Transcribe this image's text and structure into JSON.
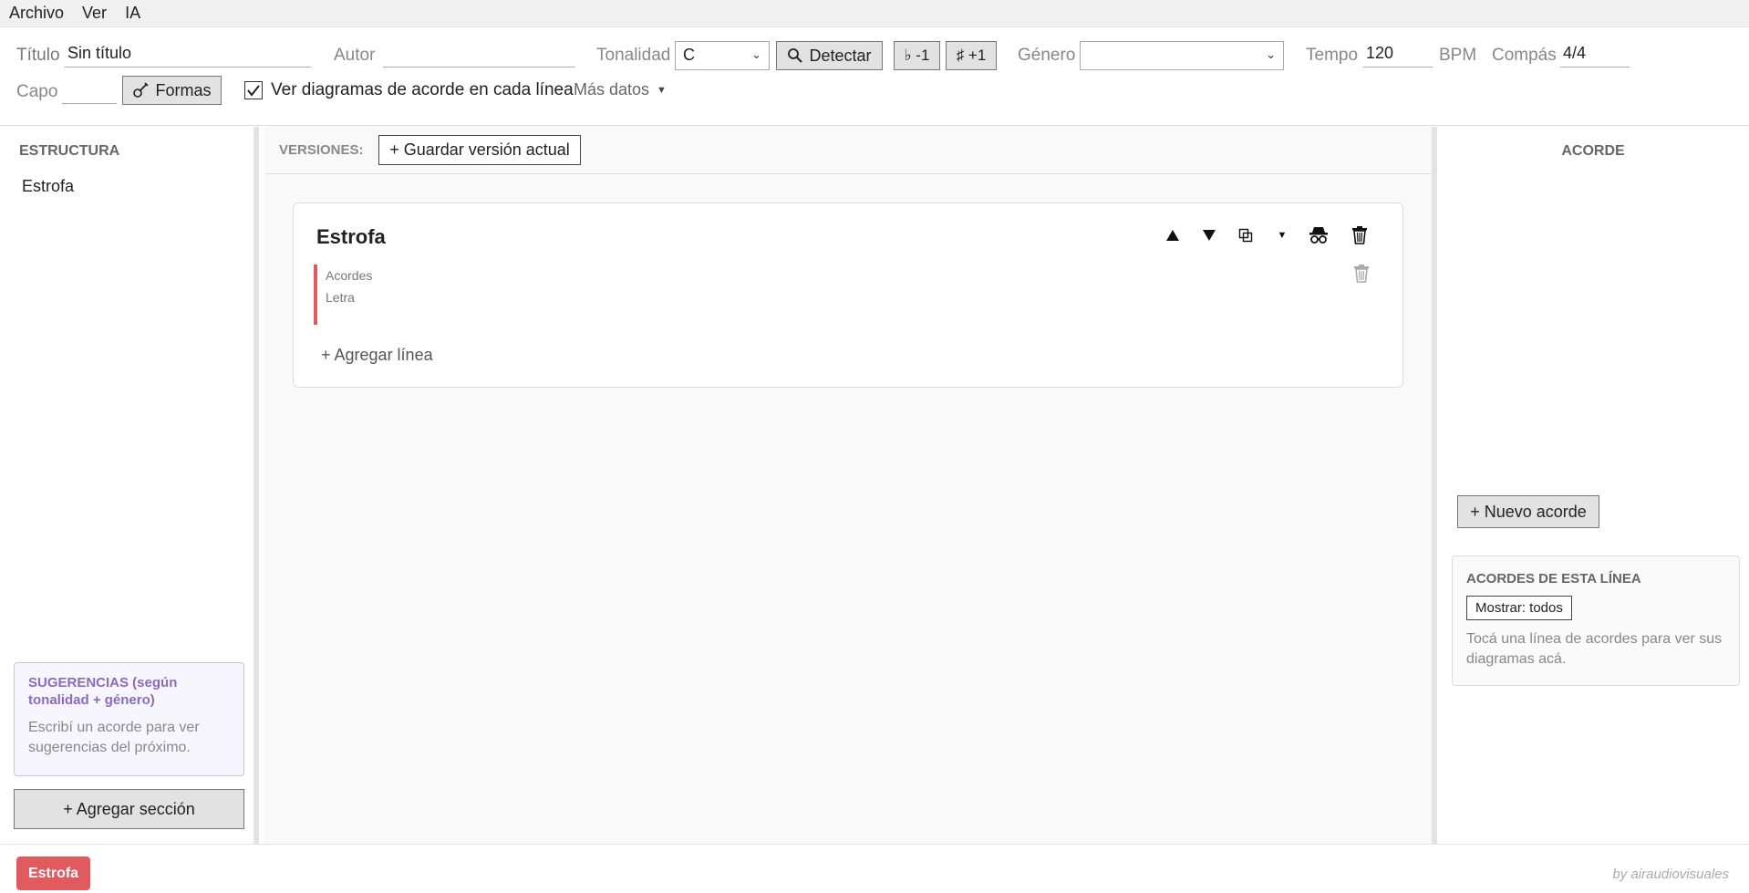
{
  "menu": {
    "items": [
      "Archivo",
      "Ver",
      "IA"
    ]
  },
  "toolbar": {
    "title_label": "Título",
    "title_value": "Sin título",
    "author_label": "Autor",
    "author_value": "",
    "key_label": "Tonalidad",
    "key_value": "C",
    "detect_label": "Detectar",
    "transpose_down_label": "♭ -1",
    "transpose_up_label": "♯ +1",
    "genre_label": "Género",
    "genre_value": "",
    "tempo_label": "Tempo",
    "tempo_value": "120",
    "bpm_label": "BPM",
    "time_sig_label": "Compás",
    "time_sig_value": "4/4",
    "capo_label": "Capo",
    "capo_value": "",
    "shapes_label": "Formas",
    "show_diagrams_label": "Ver diagramas de acorde en cada línea",
    "show_diagrams_checked": true,
    "more_data_label": "Más datos"
  },
  "sidebar": {
    "title": "ESTRUCTURA",
    "items": [
      "Estrofa"
    ],
    "suggestions_title": "SUGERENCIAS (según tonalidad + género)",
    "suggestions_text": "Escribí un acorde para ver sugerencias del próximo.",
    "add_section_label": "+ Agregar sección"
  },
  "center": {
    "versions_label": "VERSIONES:",
    "save_version_label": "+ Guardar versión actual",
    "section": {
      "title": "Estrofa",
      "line_chords_placeholder": "Acordes",
      "line_lyrics_placeholder": "Letra",
      "add_line_label": "+ Agregar línea"
    }
  },
  "right": {
    "title": "ACORDE",
    "new_chord_label": "+ Nuevo acorde",
    "line_chords_title": "ACORDES DE ESTA LÍNEA",
    "show_filter_label": "Mostrar: todos",
    "line_chords_hint": "Tocá una línea de acordes para ver sus diagramas acá."
  },
  "footer": {
    "section_chip": "Estrofa",
    "credit": "by airaudiovisuales"
  },
  "colors": {
    "accent_red": "#e05a5e",
    "suggestion_purple": "#8a6bbf"
  }
}
